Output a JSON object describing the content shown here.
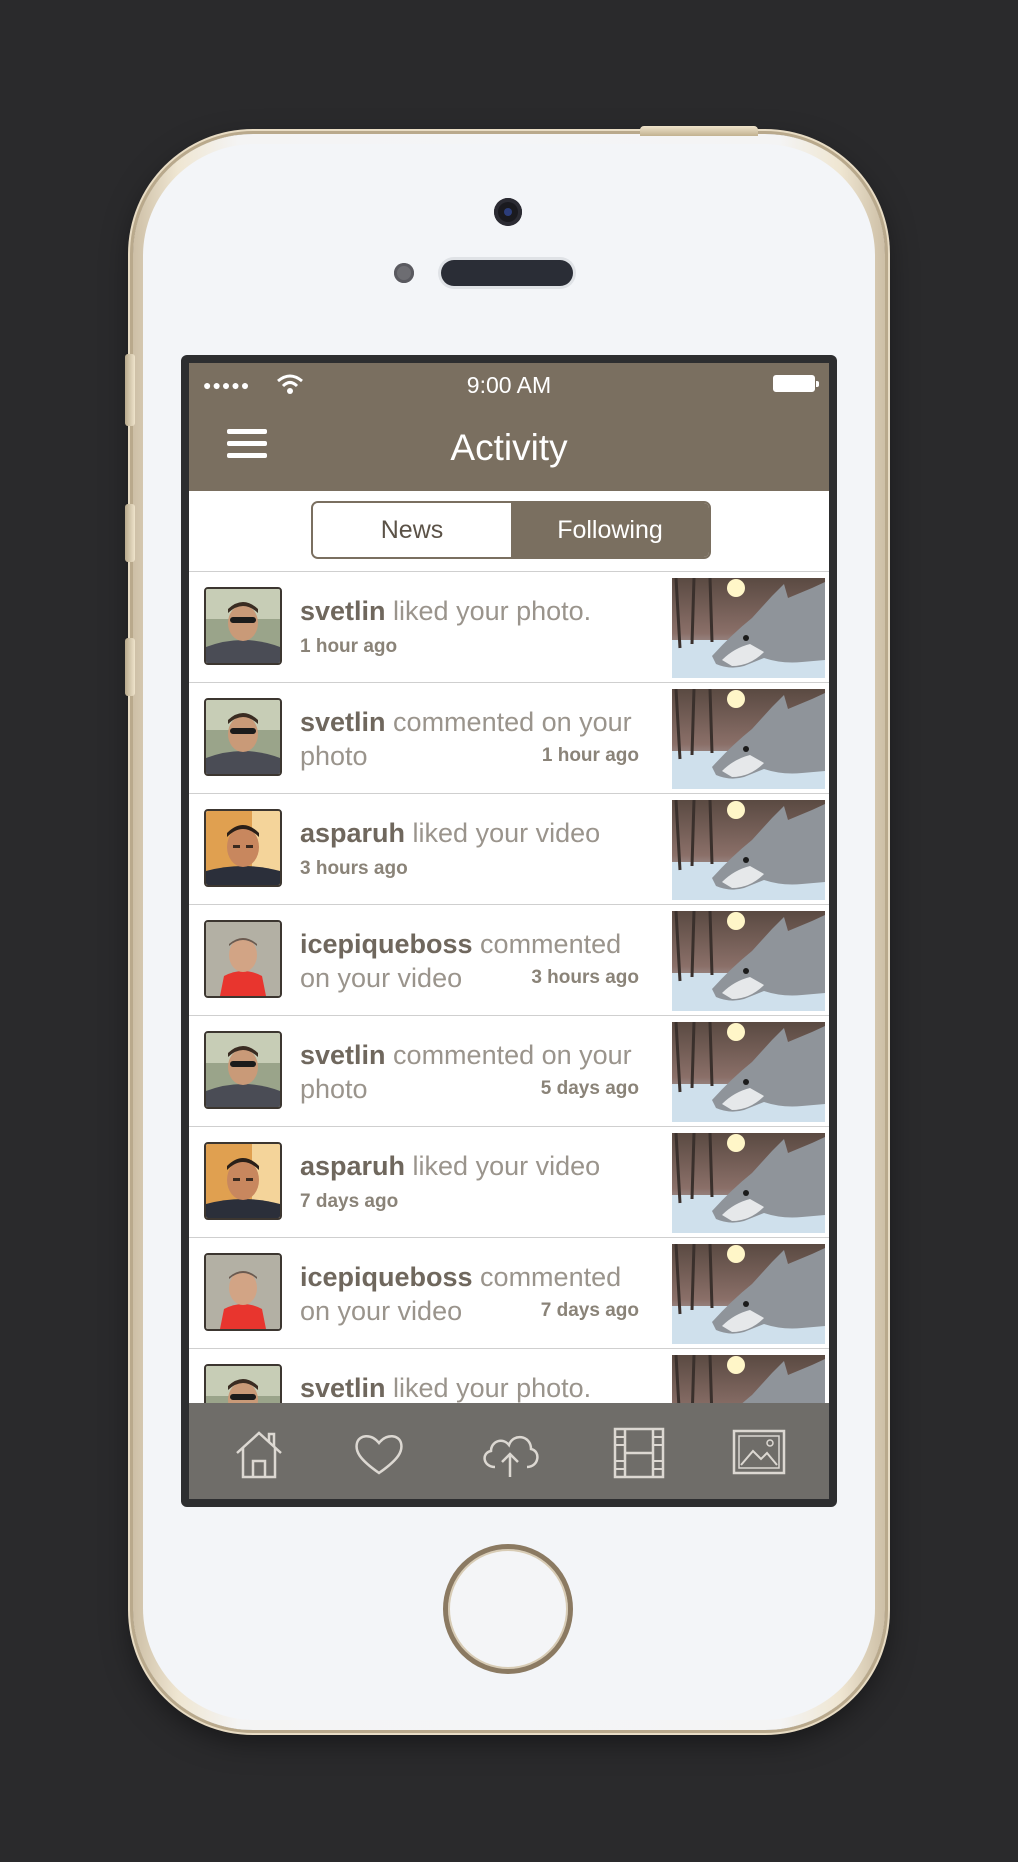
{
  "status": {
    "signal": "●●●●●",
    "time": "9:00 AM"
  },
  "nav": {
    "title": "Activity"
  },
  "segments": [
    {
      "label": "News"
    },
    {
      "label": "Following"
    }
  ],
  "feed": [
    {
      "user": "svetlin",
      "action": " liked your photo.",
      "time": "1 hour ago"
    },
    {
      "user": "svetlin",
      "action": " commented on your photo",
      "time": "1 hour ago"
    },
    {
      "user": "asparuh",
      "action": " liked your video",
      "time": "3 hours ago"
    },
    {
      "user": "icepiqueboss",
      "action": " commented on your video",
      "time": "3 hours ago"
    },
    {
      "user": "svetlin",
      "action": " commented on your photo",
      "time": "5 days ago"
    },
    {
      "user": "asparuh",
      "action": " liked your video",
      "time": "7 days ago"
    },
    {
      "user": "icepiqueboss",
      "action": " commented on your video",
      "time": "7 days ago"
    },
    {
      "user": "svetlin",
      "action": " liked your photo."
    }
  ],
  "tabs": [
    {
      "icon": "home-icon"
    },
    {
      "icon": "heart-icon"
    },
    {
      "icon": "cloud-upload-icon"
    },
    {
      "icon": "film-icon"
    },
    {
      "icon": "image-icon"
    }
  ],
  "colors": {
    "accent": "#7a6f60",
    "tabbar": "#6f6d69",
    "body_text": "#9a948c"
  }
}
